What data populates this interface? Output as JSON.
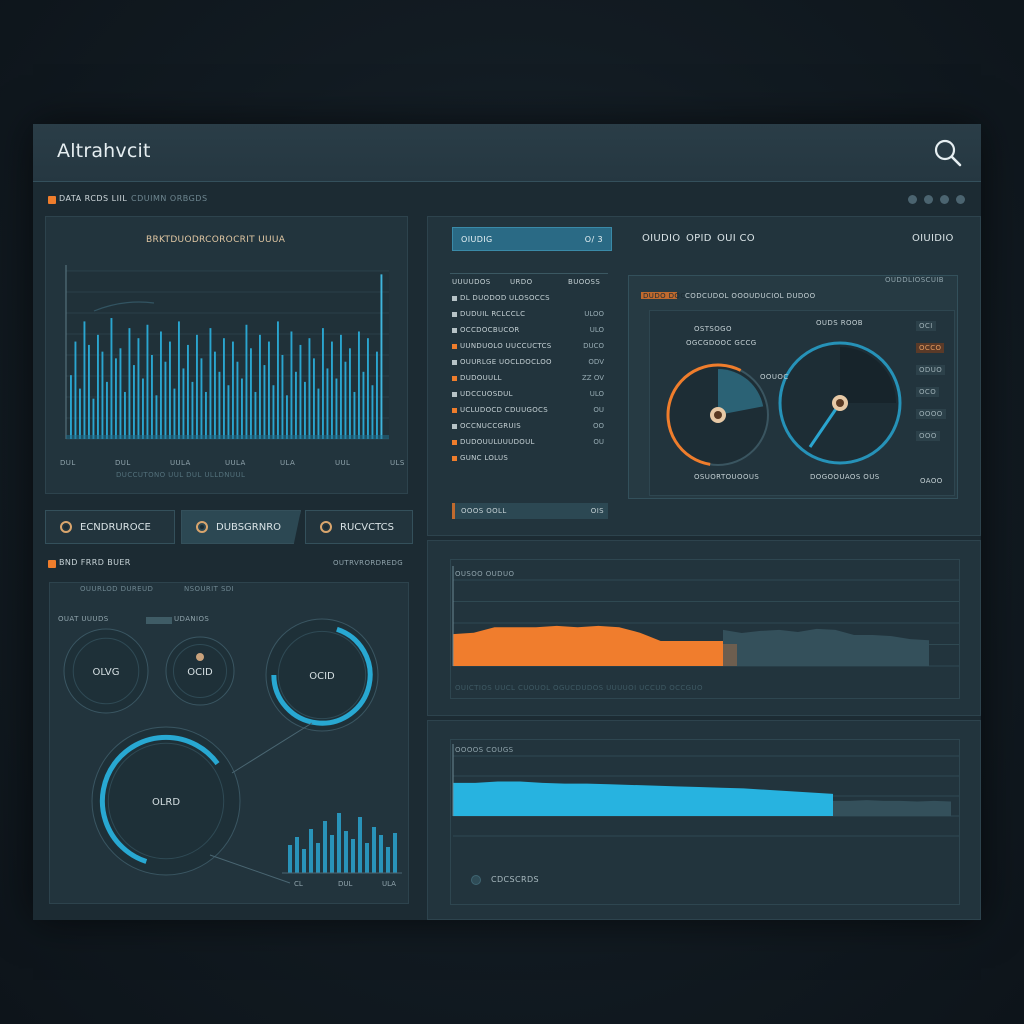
{
  "app": {
    "title": "Altrahvcit"
  },
  "subheader": {
    "label": "DATA RCDS LIIL",
    "label2": "CDUIMN ORBGDS",
    "window_dots": 4
  },
  "left_chart": {
    "title": "BRKTDUODRCOROCRIT UUUA",
    "x_ticks": [
      "DUL",
      "DUL",
      "UULA",
      "UULA",
      "ULA",
      "UUL",
      "ULS"
    ],
    "footer_text": "DUCCUTONO UUL DUL ULLDNUUL"
  },
  "tabs": [
    {
      "label": "ECNDRUROCE",
      "active": false
    },
    {
      "label": "DUBSGRNRO",
      "active": true
    },
    {
      "label": "RUCVCTCS",
      "active": false
    }
  ],
  "gauges_section": {
    "title": "BND FRRD BUER",
    "right_label": "OUTRVRORDREDG",
    "legend_left": "OUAT UUUDS",
    "legend_mid": "UDANIOS",
    "legend_right": "OUURLOD DUREUD",
    "chart_tag": "NSOURIT SDI",
    "rings": [
      {
        "label": "OLVG"
      },
      {
        "label": "OCID"
      },
      {
        "label": "OCID"
      },
      {
        "label": "OLRD"
      }
    ],
    "mini_bars_ticks": [
      "CL",
      "DUL",
      "ULA"
    ]
  },
  "top_right": {
    "select_label": "OIUDIG",
    "select_value": "O/ 3",
    "header_items": [
      "OIUDIO",
      "OPID",
      "OUI CO"
    ],
    "header_right": "OIUIDIO",
    "list_header": [
      "UUUUDOS",
      "URDO",
      "BUOOSS"
    ],
    "list_rows": [
      {
        "label": "DL DUODOD ULOSOCCS",
        "value": "",
        "accent": false
      },
      {
        "label": "DUDUIL RCLCCLC",
        "value": "ULOO",
        "accent": false
      },
      {
        "label": "OCCDOCBUCOR",
        "value": "ULO",
        "accent": false
      },
      {
        "label": "UUNDUOLO UUCCUCTCS",
        "value": "DUCO",
        "accent": true
      },
      {
        "label": "OUURLGE UOCLDOCLOO",
        "value": "ODV",
        "accent": false
      },
      {
        "label": "DUDOUULL",
        "value": "ZZ OV",
        "accent": true
      },
      {
        "label": "UDCCUOSDUL",
        "value": "ULO",
        "accent": false
      },
      {
        "label": "UCLUDOCD CDUUGOCS",
        "value": "OU",
        "accent": true
      },
      {
        "label": "OCCNUCCGRUIS",
        "value": "OO",
        "accent": false
      },
      {
        "label": "DUDOUULUUUDOUL",
        "value": "OU",
        "accent": true
      },
      {
        "label": "GUNC LOLUS",
        "value": "",
        "accent": true
      }
    ],
    "footer_select_label": "OOOS OOLL",
    "footer_select_value": "OIS"
  },
  "donut_panel": {
    "tag": "DUDO DOC",
    "title": "CODCUDOL OOOUDUCIOL DUDOO",
    "right_tag": "OUDDLIOSCUIB",
    "gauge1_title": "OSTSOGO",
    "gauge1_sub": "OGCGDOOC GCCG",
    "gauge1_bottom": "OSUORTOUOOUS",
    "gauge2_title": "OUDS ROOB",
    "gauge2_mid": "OOUOC",
    "gauge2_bottom": "DOGOOUAOS OUS",
    "legend": [
      "OCI",
      "OCCO",
      "ODUO",
      "OCO",
      "OOOO",
      "OOO"
    ],
    "bottom_right": "OAOO",
    "gauge1_fraction": 0.22,
    "gauge2_fraction": 0.25
  },
  "orange_chart": {
    "title": "OUSOO OUDUO",
    "footer": "OUICTIOS UUCL CUOUOL OGUCDUDOS UUUUOI UCCUD OCCGUO",
    "accent": "#f07d2d"
  },
  "blue_chart": {
    "title": "OOOOS COUGS",
    "legend_label": "CDCSCRDS",
    "accent": "#27b3e0"
  },
  "chart_data": [
    {
      "type": "bar",
      "title": "BRKTDUODRCOROCRIT UUUA",
      "ylim": [
        0,
        100
      ],
      "grid": true,
      "values": [
        38,
        58,
        30,
        70,
        56,
        24,
        62,
        52,
        34,
        72,
        48,
        54,
        28,
        66,
        44,
        60,
        36,
        68,
        50,
        26,
        64,
        46,
        58,
        30,
        70,
        42,
        56,
        34,
        62,
        48,
        28,
        66,
        52,
        40,
        60,
        32,
        58,
        46,
        36,
        68,
        54,
        28,
        62,
        44,
        58,
        32,
        70,
        50,
        26,
        64,
        40,
        56,
        34,
        60,
        48,
        30,
        66,
        42,
        58,
        36,
        62,
        46,
        54,
        28,
        64,
        40,
        60,
        32,
        52,
        98
      ]
    },
    {
      "type": "area",
      "title": "OUSOO OUDUO",
      "ylim": [
        0,
        100
      ],
      "x": [
        0,
        1,
        2,
        3,
        4,
        5,
        6,
        7,
        8,
        9,
        10,
        11,
        12,
        13,
        14,
        15,
        16,
        17,
        18,
        19,
        20
      ],
      "values": [
        45,
        46,
        50,
        50,
        50,
        51,
        50,
        51,
        50,
        46,
        40,
        40,
        40,
        40,
        40,
        40,
        40,
        40,
        40,
        40,
        40
      ],
      "highlight_until_index": 13,
      "tail_values": [
        35,
        32,
        34,
        35,
        33,
        36,
        35,
        30,
        30,
        29,
        26,
        25
      ]
    },
    {
      "type": "area",
      "title": "OOOOS COUGS",
      "ylim": [
        0,
        100
      ],
      "values": [
        48,
        48,
        50,
        50,
        48,
        47,
        47,
        46,
        45,
        44,
        43,
        42,
        41,
        40,
        38,
        36,
        34,
        32
      ],
      "tail_values": [
        22,
        22,
        23,
        22,
        22,
        21,
        22,
        21
      ]
    }
  ]
}
